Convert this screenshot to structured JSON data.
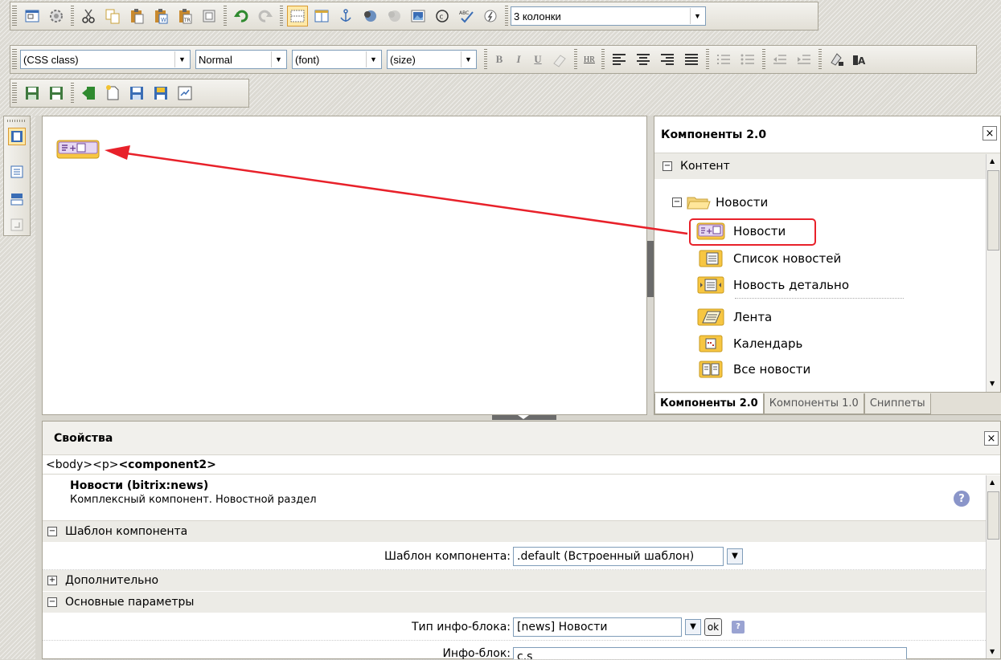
{
  "toolbar": {
    "row1_buttons": [
      "fullscreen-icon",
      "settings-icon",
      "cut-icon",
      "copy-icon",
      "paste-icon",
      "paste-word-icon",
      "paste-text-icon",
      "paste-html-icon",
      "undo-icon",
      "redo-icon",
      "table-borders-icon",
      "table-icon",
      "anchor-icon",
      "link-icon",
      "unlink-icon",
      "image-icon",
      "copyright-icon",
      "spellcheck-icon",
      "flash-icon"
    ],
    "template_select": "3 колонки",
    "style_select": "(CSS class)",
    "format_select": "Normal",
    "font_select": "(font)",
    "size_select": "(size)",
    "bold": "B",
    "italic": "I",
    "underline": "U",
    "hr": "HR",
    "row3_buttons": [
      "save-icon",
      "save-as-icon",
      "exit-icon",
      "new-page-icon",
      "save-page-icon",
      "save-close-icon",
      "properties-icon"
    ]
  },
  "left_bar": [
    "visual-mode-icon",
    "code-mode-icon",
    "split-mode-icon",
    "source-icon"
  ],
  "components_panel": {
    "title": "Компоненты 2.0",
    "close": "×",
    "section": "Контент",
    "section_toggle": "−",
    "folder": "Новости",
    "folder_toggle": "−",
    "items": [
      {
        "label": "Новости",
        "icon": "complex-news-icon"
      },
      {
        "label": "Список новостей",
        "icon": "news-list-icon"
      },
      {
        "label": "Новость детально",
        "icon": "news-detail-icon"
      },
      {
        "label": "Лента",
        "icon": "feed-icon"
      },
      {
        "label": "Календарь",
        "icon": "calendar-icon"
      },
      {
        "label": "Все новости",
        "icon": "all-news-icon"
      }
    ],
    "tabs": [
      "Компоненты 2.0",
      "Компоненты 1.0",
      "Сниппеты"
    ]
  },
  "properties": {
    "title": "Свойства",
    "close": "×",
    "crumb_plain": "<body><p>",
    "crumb_bold": "<component2>",
    "component_title": "Новости (bitrix:news)",
    "component_desc": "Комплексный компонент. Новостной раздел",
    "help": "?",
    "group_template": "Шаблон компонента",
    "template_label": "Шаблон компонента:",
    "template_value": ".default (Встроенный шаблон)",
    "group_additional": "Дополнительно",
    "group_main": "Основные параметры",
    "iblock_type_label": "Тип инфо-блока:",
    "iblock_type_value": "[news] Новости",
    "ok": "ok",
    "iblock_label": "Инфо-блок:",
    "iblock_value": "c.s",
    "toggle_minus": "−",
    "toggle_plus": "+"
  },
  "colors": {
    "annotation": "#e8212a",
    "component_icon": "#f7c642"
  }
}
